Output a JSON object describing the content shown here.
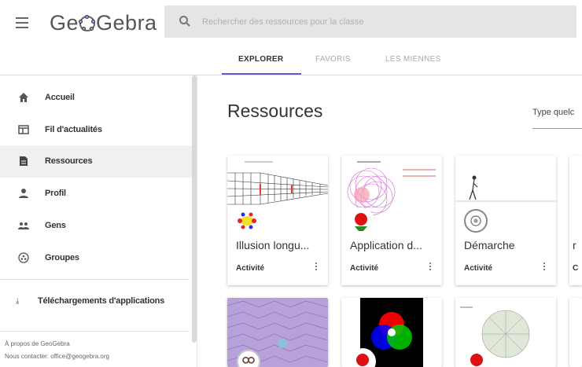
{
  "header": {
    "logo_text": "GeoGebra",
    "search_placeholder": "Rechercher des ressources pour la classe"
  },
  "tabs": [
    {
      "label": "EXPLORER",
      "active": true
    },
    {
      "label": "FAVORIS",
      "active": false
    },
    {
      "label": "LES MIENNES",
      "active": false
    }
  ],
  "sidebar": {
    "items": [
      {
        "label": "Accueil",
        "icon": "home-icon"
      },
      {
        "label": "Fil d'actualités",
        "icon": "news-feed-icon"
      },
      {
        "label": "Ressources",
        "icon": "document-icon",
        "active": true
      },
      {
        "label": "Profil",
        "icon": "person-icon"
      },
      {
        "label": "Gens",
        "icon": "people-icon"
      },
      {
        "label": "Groupes",
        "icon": "groups-icon"
      }
    ],
    "downloads_label": "Téléchargements d'applications",
    "footer": {
      "about": "À propos de GeoGebra",
      "contact": "Nous contacter: office@geogebra.org"
    }
  },
  "main": {
    "title": "Ressources",
    "type_filter": "Type quelc",
    "cards": [
      {
        "title": "Illusion longu...",
        "type": "Activité"
      },
      {
        "title": "Application d...",
        "type": "Activité"
      },
      {
        "title": "Démarche",
        "type": "Activité"
      },
      {
        "title": "",
        "type": ""
      },
      {
        "title": "",
        "type": ""
      },
      {
        "title": "",
        "type": ""
      }
    ],
    "partial_card_letters": [
      "r",
      "C"
    ]
  },
  "colors": {
    "accent": "#6557d2",
    "search_bg": "#e5e5e5",
    "active_nav_bg": "#f0f0f0"
  }
}
